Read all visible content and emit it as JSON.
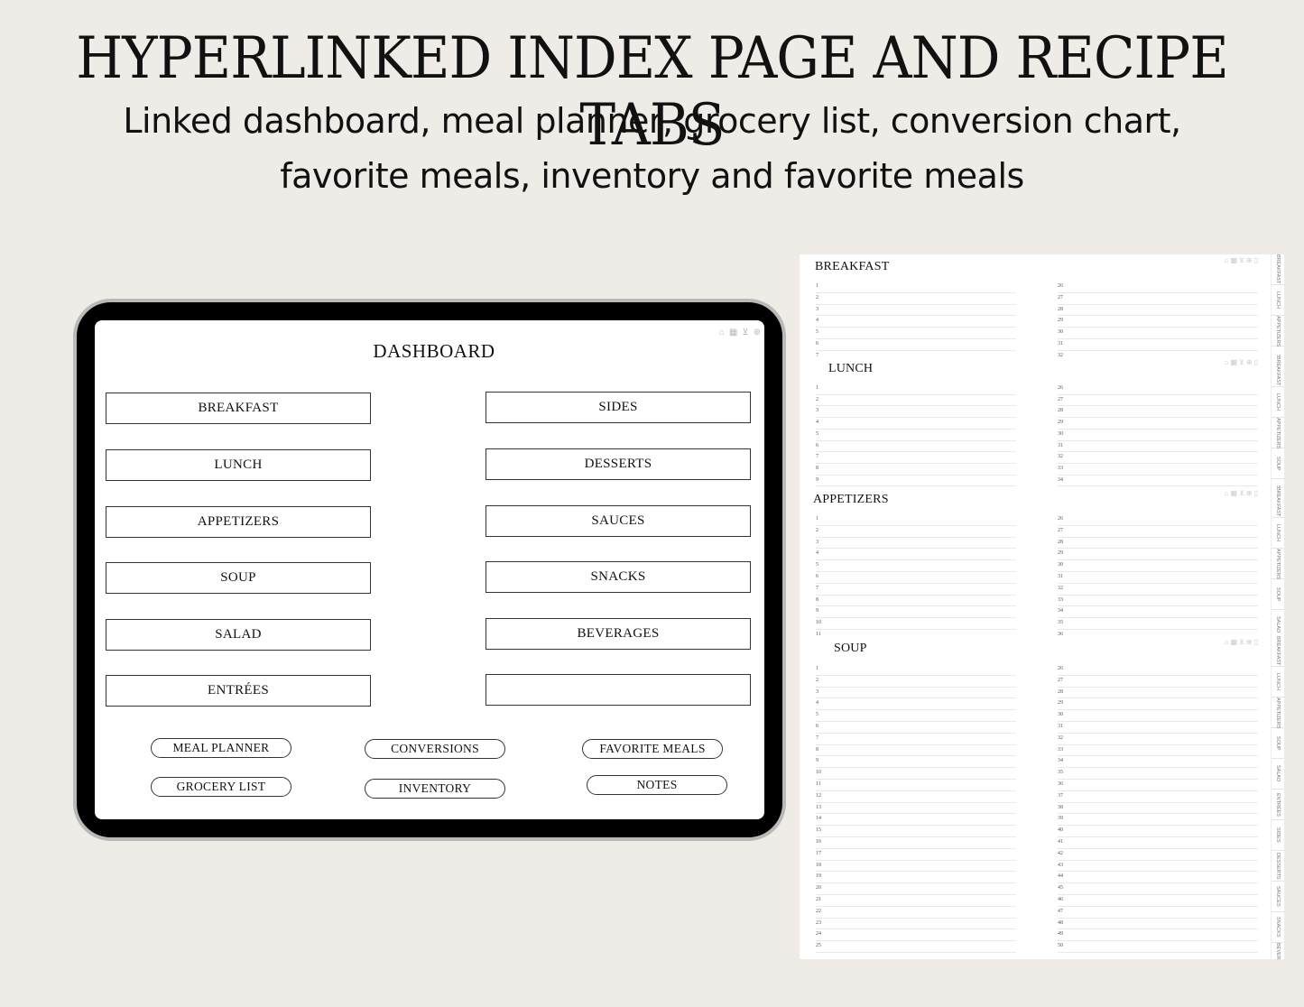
{
  "header": {
    "title": "HYPERLINKED INDEX PAGE AND RECIPE TABS",
    "subtitle_line1": "Linked dashboard, meal planner, grocery list, conversion chart,",
    "subtitle_line2": "favorite meals, inventory and favorite meals"
  },
  "dashboard": {
    "title": "DASHBOARD",
    "nav_icons": [
      "home-icon",
      "calendar-icon",
      "basket-icon",
      "scale-icon",
      "note-icon"
    ],
    "left_buttons": [
      "BREAKFAST",
      "LUNCH",
      "APPETIZERS",
      "SOUP",
      "SALAD",
      "ENTRÉES"
    ],
    "right_buttons": [
      "SIDES",
      "DESSERTS",
      "SAUCES",
      "SNACKS",
      "BEVERAGES",
      ""
    ],
    "links": [
      "MEAL PLANNER",
      "CONVERSIONS",
      "FAVORITE MEALS",
      "GROCERY LIST",
      "INVENTORY",
      "NOTES"
    ]
  },
  "tabs": [
    "BREAKFAST",
    "LUNCH",
    "APPETIZERS",
    "SOUP",
    "SALAD",
    "ENTRÉES",
    "SIDES",
    "DESSERTS",
    "SAUCES",
    "SNACKS",
    "BEVERAGES"
  ],
  "pages": [
    {
      "title": "BREAKFAST",
      "left": [
        1,
        2,
        3,
        4,
        5,
        6,
        7
      ],
      "right": [
        26,
        27,
        28,
        29,
        30,
        31,
        32
      ]
    },
    {
      "title": "LUNCH",
      "left": [
        1,
        2,
        3,
        4,
        5,
        6,
        7,
        8,
        9
      ],
      "right": [
        26,
        27,
        28,
        29,
        30,
        31,
        32,
        33,
        34
      ]
    },
    {
      "title": "APPETIZERS",
      "left": [
        1,
        2,
        3,
        4,
        5,
        6,
        7,
        8,
        9,
        10,
        11
      ],
      "right": [
        26,
        27,
        28,
        29,
        30,
        31,
        32,
        33,
        34,
        35,
        36
      ]
    },
    {
      "title": "SOUP",
      "left": [
        1,
        2,
        3,
        4,
        5,
        6,
        7,
        8,
        9,
        10,
        11,
        12,
        13,
        14,
        15,
        16,
        17,
        18,
        19,
        20,
        21,
        22,
        23,
        24,
        25
      ],
      "right": [
        26,
        27,
        28,
        29,
        30,
        31,
        32,
        33,
        34,
        35,
        36,
        37,
        38,
        39,
        40,
        41,
        42,
        43,
        44,
        45,
        46,
        47,
        48,
        49,
        50
      ]
    }
  ]
}
